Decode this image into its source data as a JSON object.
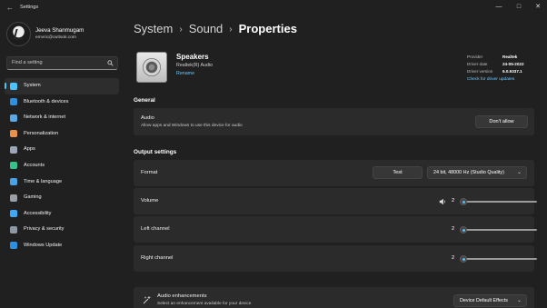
{
  "window": {
    "title": "Settings",
    "controls": {
      "minimize": "—",
      "maximize": "□",
      "close": "✕"
    }
  },
  "profile": {
    "name": "Jeeva Shanmugam",
    "email": "emvric@outlook.com"
  },
  "search": {
    "placeholder": "Find a setting"
  },
  "sidebar": {
    "items": [
      {
        "label": "System",
        "icon": "monitor-icon",
        "color": "#4cc2ff",
        "active": true
      },
      {
        "label": "Bluetooth & devices",
        "icon": "bluetooth-icon",
        "color": "#2f8fdc"
      },
      {
        "label": "Network & internet",
        "icon": "wifi-icon",
        "color": "#5aa9e6"
      },
      {
        "label": "Personalization",
        "icon": "brush-icon",
        "color": "#e8914a"
      },
      {
        "label": "Apps",
        "icon": "apps-icon",
        "color": "#9aa7b8"
      },
      {
        "label": "Accounts",
        "icon": "person-icon",
        "color": "#35c28a"
      },
      {
        "label": "Time & language",
        "icon": "globe-clock-icon",
        "color": "#4aa3e8"
      },
      {
        "label": "Gaming",
        "icon": "gamepad-icon",
        "color": "#9aa0a8"
      },
      {
        "label": "Accessibility",
        "icon": "accessibility-icon",
        "color": "#3fa9f5"
      },
      {
        "label": "Privacy & security",
        "icon": "shield-icon",
        "color": "#8d97a5"
      },
      {
        "label": "Windows Update",
        "icon": "update-icon",
        "color": "#2d8fe0"
      }
    ]
  },
  "breadcrumb": {
    "part1": "System",
    "part2": "Sound",
    "part3": "Properties",
    "sep": "›"
  },
  "device": {
    "name": "Speakers",
    "subtitle": "Realtek(R) Audio",
    "rename": "Rename"
  },
  "driver_info": {
    "provider_label": "Provider",
    "provider_value": "Realtek",
    "date_label": "Driver date",
    "date_value": "24-05-2022",
    "version_label": "Driver version",
    "version_value": "6.0.9337.1",
    "check_link": "Check for driver updates"
  },
  "general": {
    "title": "General",
    "audio": {
      "title": "Audio",
      "desc": "Allow apps and Windows to use this device for audio",
      "button": "Don't allow"
    }
  },
  "output": {
    "title": "Output settings",
    "format": {
      "label": "Format",
      "test_button": "Test",
      "selected": "24 bit, 48000 Hz (Studio Quality)"
    },
    "volume": {
      "label": "Volume",
      "value": "2",
      "level": 0.03
    },
    "left": {
      "label": "Left channel",
      "value": "2",
      "level": 0.03
    },
    "right": {
      "label": "Right channel",
      "value": "2",
      "level": 0.03
    }
  },
  "enhancements": {
    "title": "Audio enhancements",
    "desc": "Select an enhancement available for your device",
    "selected": "Device Default Effects"
  },
  "accent": "#4cc2ff"
}
